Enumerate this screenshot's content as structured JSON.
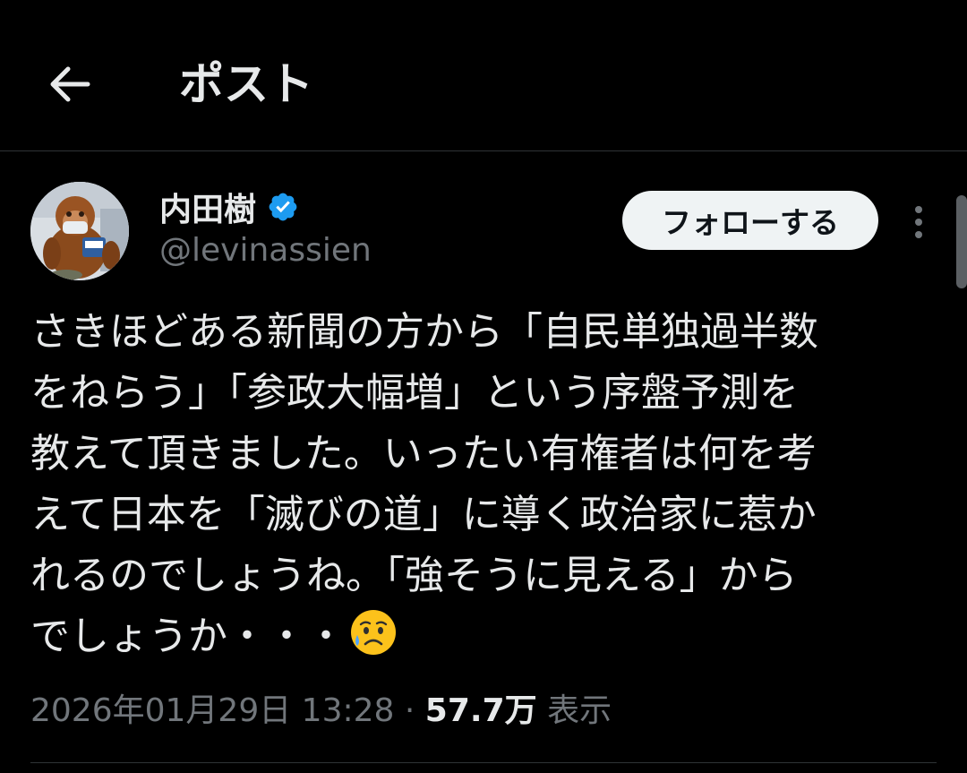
{
  "header": {
    "back_icon": "arrow-left-icon",
    "title": "ポスト"
  },
  "author": {
    "display_name": "内田樹",
    "handle": "@levinassien",
    "verified": true,
    "verified_icon": "verified-badge-icon",
    "verified_color": "#1d9bf0"
  },
  "follow_button": {
    "label": "フォローする"
  },
  "more_icon": "more-vertical-icon",
  "tweet": {
    "lines": [
      "さきほどある新聞の方から「自民単独過半数",
      "をねらう」「参政大幅増」という序盤予測を",
      "教えて頂きました。いったい有権者は何を考",
      "えて日本を「滅びの道」に導く政治家に惹か",
      "れるのでしょうね。「強そうに見える」から",
      "でしょうか・・・"
    ],
    "emoji": "sad-but-relieved-face-emoji"
  },
  "meta": {
    "timestamp": "2026年01月29日 13:28",
    "separator": "·",
    "views_count": "57.7万",
    "views_label": "表示"
  },
  "colors": {
    "background": "#000000",
    "text_primary": "#e7e9ea",
    "text_secondary": "#71767b",
    "divider": "#2f3336",
    "follow_bg": "#eff3f4"
  }
}
